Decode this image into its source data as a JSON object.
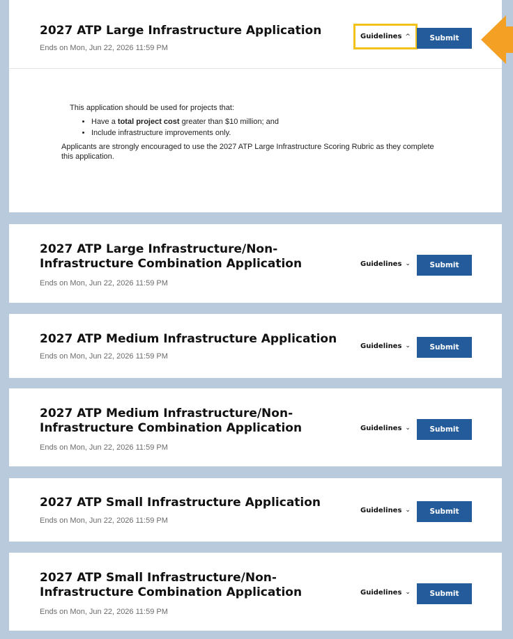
{
  "cards": [
    {
      "title": "2027 ATP Large Infrastructure Application",
      "ends": "Ends on Mon, Jun 22, 2026 11:59 PM",
      "guidelines_label": "Guidelines",
      "guidelines_chevron": "^",
      "submit_label": "Submit",
      "expanded": true,
      "guidelines": {
        "intro": "This application should be used for projects that:",
        "bullets": [
          {
            "pre": "Have a ",
            "bold": "total project cost",
            "post": " greater than $10 million; and"
          },
          {
            "pre": "Include infrastructure improvements only.",
            "bold": "",
            "post": ""
          }
        ],
        "note": "Applicants are strongly encouraged to use the 2027 ATP Large Infrastructure Scoring Rubric as they complete this application."
      }
    },
    {
      "title": "2027 ATP Large Infrastructure/Non-Infrastructure Combination Application",
      "ends": "Ends on Mon, Jun 22, 2026 11:59 PM",
      "guidelines_label": "Guidelines",
      "guidelines_chevron": "⌄",
      "submit_label": "Submit"
    },
    {
      "title": "2027 ATP Medium Infrastructure Application",
      "ends": "Ends on Mon, Jun 22, 2026 11:59 PM",
      "guidelines_label": "Guidelines",
      "guidelines_chevron": "⌄",
      "submit_label": "Submit"
    },
    {
      "title": "2027 ATP Medium Infrastructure/Non-Infrastructure Combination Application",
      "ends": "Ends on Mon, Jun 22, 2026 11:59 PM",
      "guidelines_label": "Guidelines",
      "guidelines_chevron": "⌄",
      "submit_label": "Submit"
    },
    {
      "title": "2027 ATP Small Infrastructure Application",
      "ends": "Ends on Mon, Jun 22, 2026 11:59 PM",
      "guidelines_label": "Guidelines",
      "guidelines_chevron": "⌄",
      "submit_label": "Submit"
    },
    {
      "title": "2027 ATP Small Infrastructure/Non-Infrastructure Combination Application",
      "ends": "Ends on Mon, Jun 22, 2026 11:59 PM",
      "guidelines_label": "Guidelines",
      "guidelines_chevron": "⌄",
      "submit_label": "Submit"
    }
  ],
  "colors": {
    "background": "#b9cadd",
    "submit": "#245b9a",
    "highlight_box": "#f2c21b",
    "arrow": "#f4a025"
  }
}
